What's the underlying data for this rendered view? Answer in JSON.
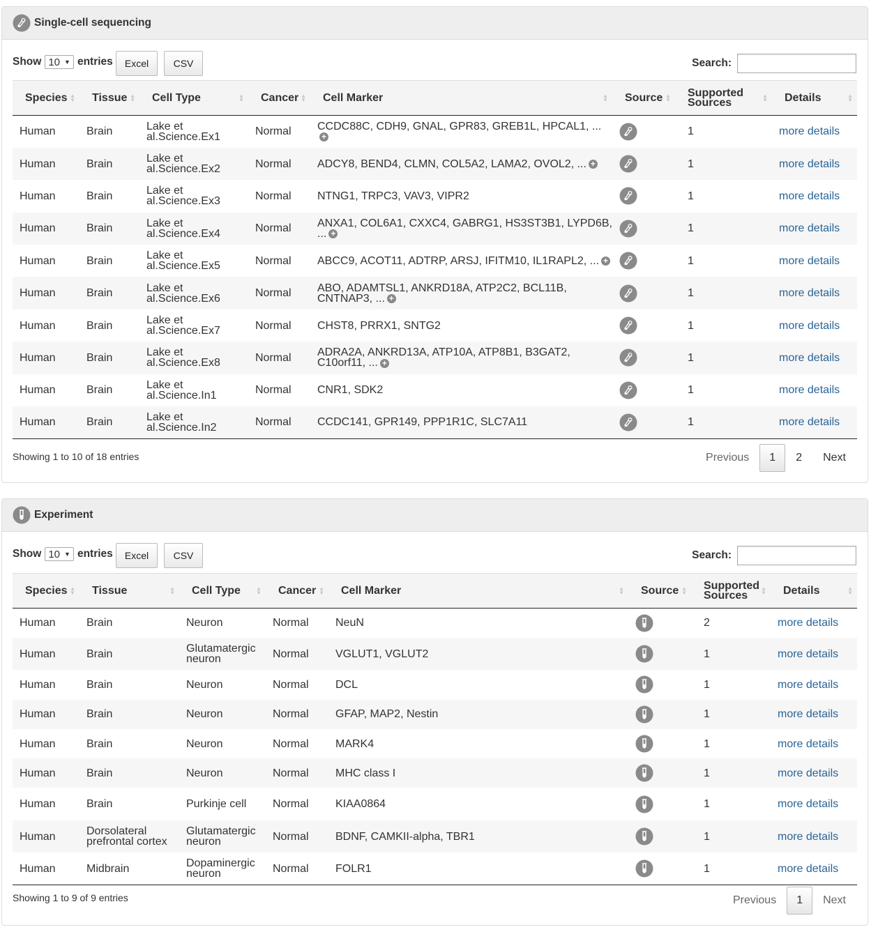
{
  "panel1": {
    "title": "Single-cell sequencing",
    "show_label": "Show",
    "entries_label": "entries",
    "page_size": "10",
    "excel_label": "Excel",
    "csv_label": "CSV",
    "search_label": "Search:",
    "columns": [
      "Species",
      "Tissue",
      "Cell Type",
      "Cancer",
      "Cell Marker",
      "Source",
      "Supported Sources",
      "Details"
    ],
    "rows": [
      {
        "species": "Human",
        "tissue": "Brain",
        "cell_type": "Lake et al.Science.Ex1",
        "cancer": "Normal",
        "marker": "CCDC88C, CDH9, GNAL, GPR83, GREB1L, HPCAL1, ...",
        "sources": "1",
        "details": "more details"
      },
      {
        "species": "Human",
        "tissue": "Brain",
        "cell_type": "Lake et al.Science.Ex2",
        "cancer": "Normal",
        "marker": "ADCY8, BEND4, CLMN, COL5A2, LAMA2, OVOL2, ...",
        "sources": "1",
        "details": "more details"
      },
      {
        "species": "Human",
        "tissue": "Brain",
        "cell_type": "Lake et al.Science.Ex3",
        "cancer": "Normal",
        "marker": "NTNG1, TRPC3, VAV3, VIPR2",
        "sources": "1",
        "details": "more details"
      },
      {
        "species": "Human",
        "tissue": "Brain",
        "cell_type": "Lake et al.Science.Ex4",
        "cancer": "Normal",
        "marker": "ANXA1, COL6A1, CXXC4, GABRG1, HS3ST3B1, LYPD6B, ...",
        "sources": "1",
        "details": "more details"
      },
      {
        "species": "Human",
        "tissue": "Brain",
        "cell_type": "Lake et al.Science.Ex5",
        "cancer": "Normal",
        "marker": "ABCC9, ACOT11, ADTRP, ARSJ, IFITM10, IL1RAPL2, ...",
        "sources": "1",
        "details": "more details"
      },
      {
        "species": "Human",
        "tissue": "Brain",
        "cell_type": "Lake et al.Science.Ex6",
        "cancer": "Normal",
        "marker": "ABO, ADAMTSL1, ANKRD18A, ATP2C2, BCL11B, CNTNAP3, ...",
        "sources": "1",
        "details": "more details"
      },
      {
        "species": "Human",
        "tissue": "Brain",
        "cell_type": "Lake et al.Science.Ex7",
        "cancer": "Normal",
        "marker": "CHST8, PRRX1, SNTG2",
        "sources": "1",
        "details": "more details"
      },
      {
        "species": "Human",
        "tissue": "Brain",
        "cell_type": "Lake et al.Science.Ex8",
        "cancer": "Normal",
        "marker": "ADRA2A, ANKRD13A, ATP10A, ATP8B1, B3GAT2, C10orf11, ...",
        "sources": "1",
        "details": "more details"
      },
      {
        "species": "Human",
        "tissue": "Brain",
        "cell_type": "Lake et al.Science.In1",
        "cancer": "Normal",
        "marker": "CNR1, SDK2",
        "sources": "1",
        "details": "more details"
      },
      {
        "species": "Human",
        "tissue": "Brain",
        "cell_type": "Lake et al.Science.In2",
        "cancer": "Normal",
        "marker": "CCDC141, GPR149, PPP1R1C, SLC7A11",
        "sources": "1",
        "details": "more details"
      }
    ],
    "info": "Showing 1 to 10 of 18 entries",
    "pager": {
      "previous": "Previous",
      "pages": [
        "1",
        "2"
      ],
      "next": "Next"
    }
  },
  "panel2": {
    "title": "Experiment",
    "show_label": "Show",
    "entries_label": "entries",
    "page_size": "10",
    "excel_label": "Excel",
    "csv_label": "CSV",
    "search_label": "Search:",
    "columns": [
      "Species",
      "Tissue",
      "Cell Type",
      "Cancer",
      "Cell Marker",
      "Source",
      "Supported Sources",
      "Details"
    ],
    "rows": [
      {
        "species": "Human",
        "tissue": "Brain",
        "cell_type": "Neuron",
        "cancer": "Normal",
        "marker": "NeuN",
        "sources": "2",
        "details": "more details"
      },
      {
        "species": "Human",
        "tissue": "Brain",
        "cell_type": "Glutamatergic neuron",
        "cancer": "Normal",
        "marker": "VGLUT1, VGLUT2",
        "sources": "1",
        "details": "more details"
      },
      {
        "species": "Human",
        "tissue": "Brain",
        "cell_type": "Neuron",
        "cancer": "Normal",
        "marker": "DCL",
        "sources": "1",
        "details": "more details"
      },
      {
        "species": "Human",
        "tissue": "Brain",
        "cell_type": "Neuron",
        "cancer": "Normal",
        "marker": "GFAP, MAP2, Nestin",
        "sources": "1",
        "details": "more details"
      },
      {
        "species": "Human",
        "tissue": "Brain",
        "cell_type": "Neuron",
        "cancer": "Normal",
        "marker": "MARK4",
        "sources": "1",
        "details": "more details"
      },
      {
        "species": "Human",
        "tissue": "Brain",
        "cell_type": "Neuron",
        "cancer": "Normal",
        "marker": "MHC class I",
        "sources": "1",
        "details": "more details"
      },
      {
        "species": "Human",
        "tissue": "Brain",
        "cell_type": "Purkinje cell",
        "cancer": "Normal",
        "marker": "KIAA0864",
        "sources": "1",
        "details": "more details"
      },
      {
        "species": "Human",
        "tissue": "Dorsolateral prefrontal cortex",
        "cell_type": "Glutamatergic neuron",
        "cancer": "Normal",
        "marker": "BDNF, CAMKII-alpha, TBR1",
        "sources": "1",
        "details": "more details"
      },
      {
        "species": "Human",
        "tissue": "Midbrain",
        "cell_type": "Dopaminergic neuron",
        "cancer": "Normal",
        "marker": "FOLR1",
        "sources": "1",
        "details": "more details"
      }
    ],
    "info": "Showing 1 to 9 of 9 entries",
    "pager": {
      "previous": "Previous",
      "pages": [
        "1"
      ],
      "next": "Next"
    }
  },
  "icons": {
    "panel1_header": "sequencing-icon",
    "panel2_header": "experiment-tube-icon",
    "expand": "plus-circle-icon",
    "sort": "sort-arrows-icon"
  },
  "colors": {
    "link": "#2a6496",
    "header_bg": "#eeeeee",
    "icon_gray": "#8a8a8a"
  }
}
